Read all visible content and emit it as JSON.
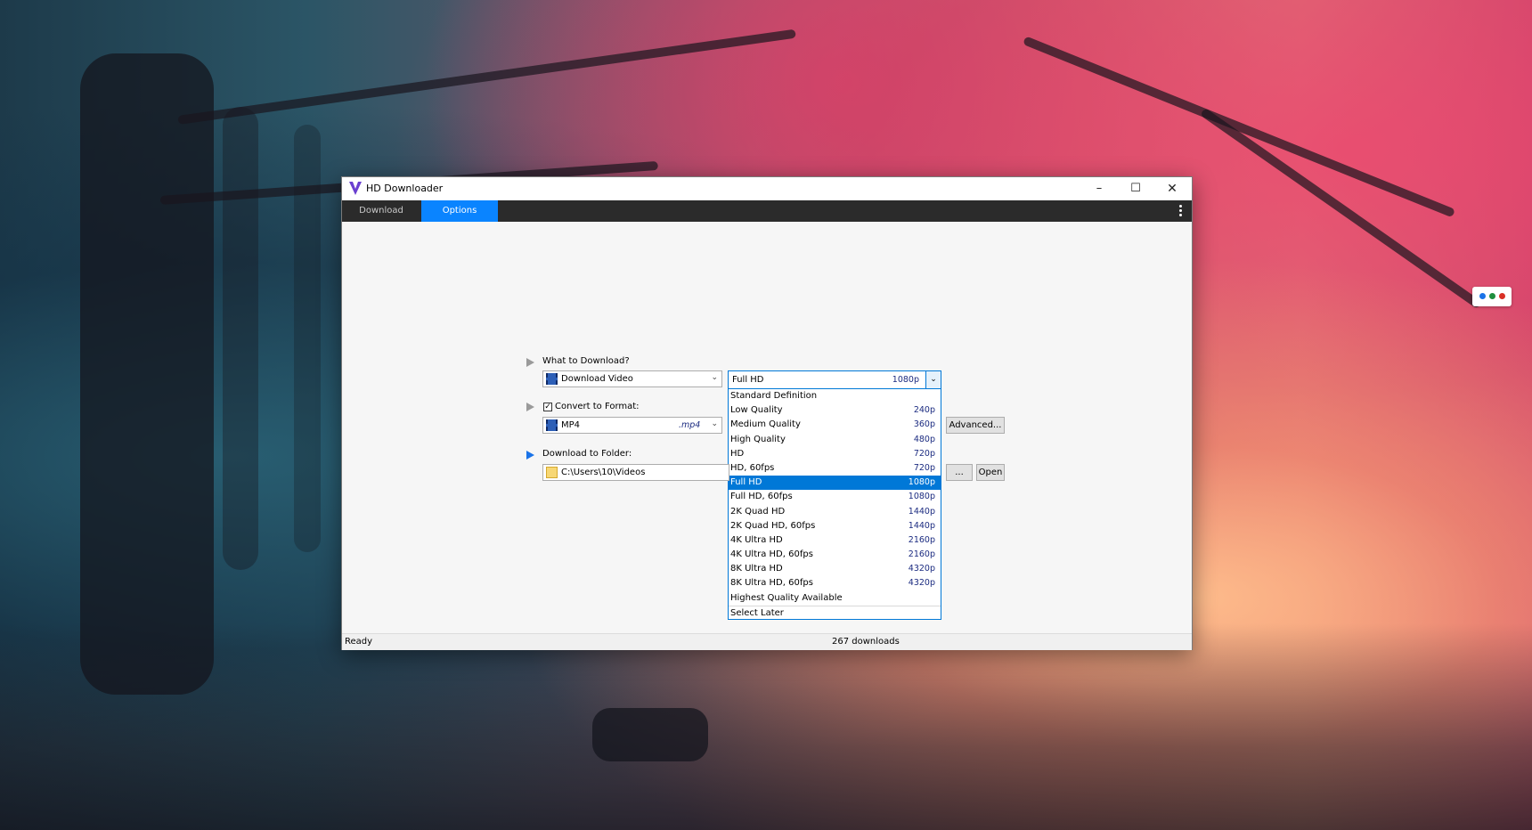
{
  "window": {
    "title": "HD Downloader",
    "controls": {
      "minimize": "–",
      "maximize": "☐",
      "close": "✕"
    }
  },
  "tabs": [
    {
      "label": "Download",
      "active": false
    },
    {
      "label": "Options",
      "active": true
    }
  ],
  "what_to_download": {
    "label": "What to Download?",
    "value": "Download Video"
  },
  "quality": {
    "selected_label": "Full HD",
    "selected_res": "1080p",
    "options": [
      {
        "label": "Standard Definition",
        "res": ""
      },
      {
        "label": "Low Quality",
        "res": "240p"
      },
      {
        "label": "Medium Quality",
        "res": "360p"
      },
      {
        "label": "High Quality",
        "res": "480p"
      },
      {
        "label": "HD",
        "res": "720p"
      },
      {
        "label": "HD, 60fps",
        "res": "720p"
      },
      {
        "label": "Full HD",
        "res": "1080p"
      },
      {
        "label": "Full HD, 60fps",
        "res": "1080p"
      },
      {
        "label": "2K Quad HD",
        "res": "1440p"
      },
      {
        "label": "2K Quad HD, 60fps",
        "res": "1440p"
      },
      {
        "label": "4K Ultra HD",
        "res": "2160p"
      },
      {
        "label": "4K Ultra HD, 60fps",
        "res": "2160p"
      },
      {
        "label": "8K Ultra HD",
        "res": "4320p"
      },
      {
        "label": "8K Ultra HD, 60fps",
        "res": "4320p"
      },
      {
        "label": "Highest Quality Available",
        "res": ""
      },
      {
        "label": "Select Later",
        "res": ""
      }
    ]
  },
  "convert": {
    "label": "Convert to Format:",
    "checked": true,
    "format": "MP4",
    "ext": ".mp4",
    "advanced_button": "Advanced..."
  },
  "folder": {
    "label": "Download to Folder:",
    "path": "C:\\Users\\10\\Videos",
    "browse_button": "...",
    "open_button": "Open"
  },
  "status": {
    "left": "Ready",
    "center": "267 downloads"
  },
  "colors": {
    "accent": "#0a84ff",
    "tabbar": "#2b2b2b",
    "selection": "#0078d7"
  }
}
